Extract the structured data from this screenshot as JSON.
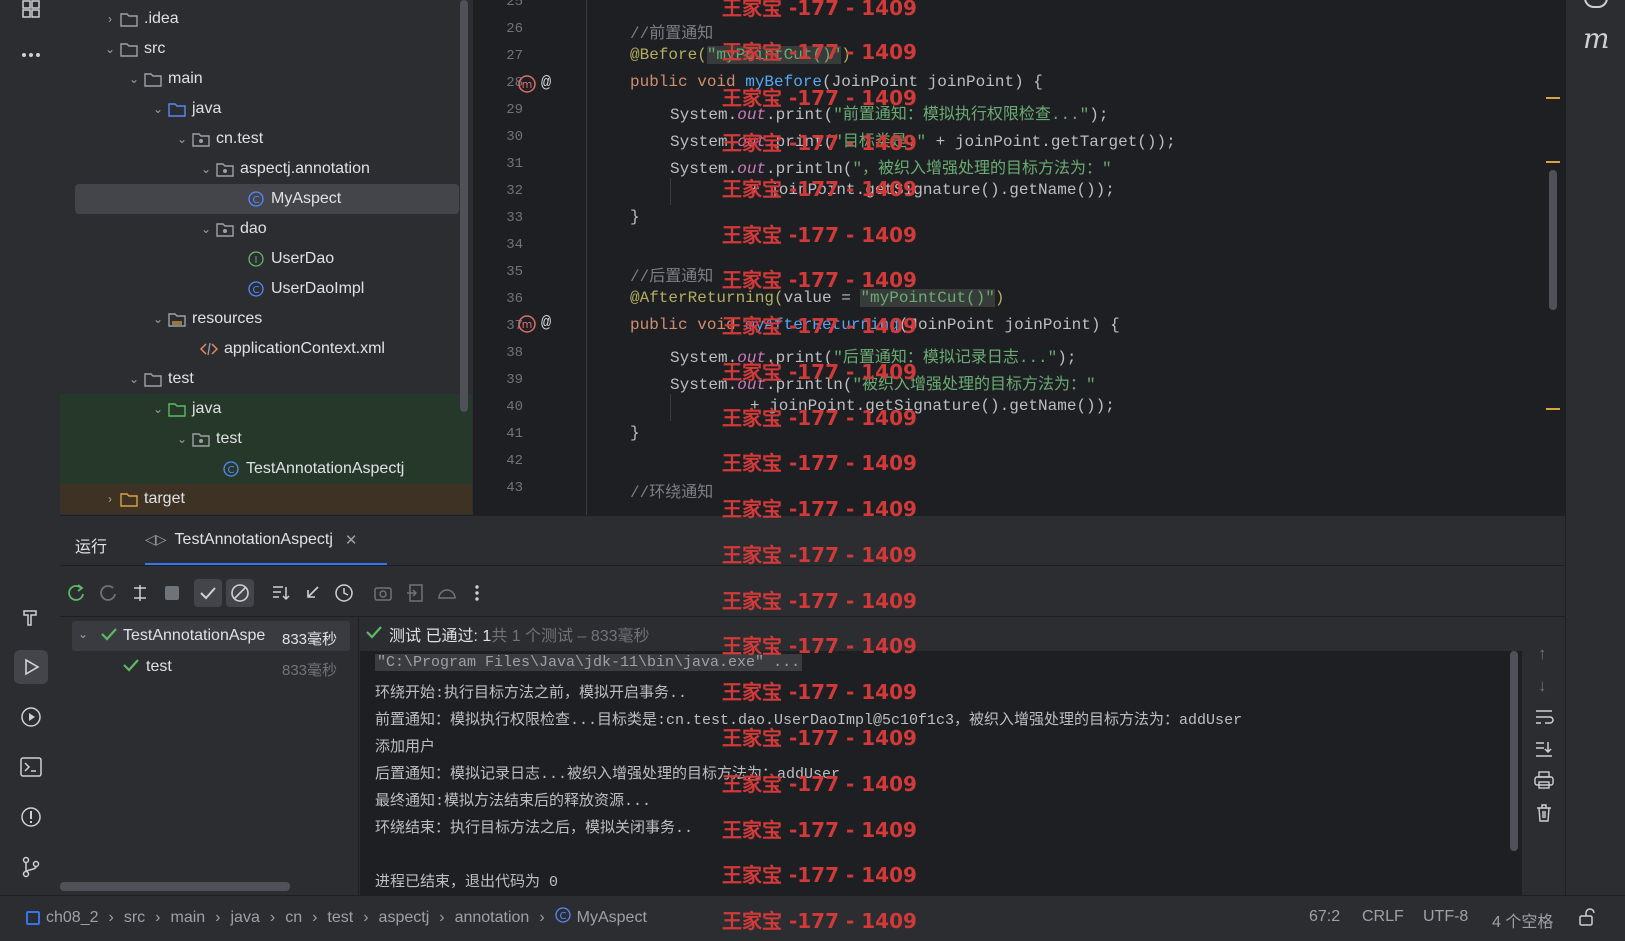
{
  "left_tools": [
    "project-icon",
    "more-icon",
    "build-icon",
    "run-icon",
    "services-icon",
    "terminal-icon",
    "problems-icon",
    "git-icon"
  ],
  "tree": {
    "items": [
      {
        "label": ".idea",
        "type": "folder",
        "expanded": false
      },
      {
        "label": "src",
        "type": "folder",
        "expanded": true
      },
      {
        "label": "main",
        "type": "folder",
        "expanded": true
      },
      {
        "label": "java",
        "type": "source-folder",
        "expanded": true
      },
      {
        "label": "cn.test",
        "type": "package",
        "expanded": true
      },
      {
        "label": "aspectj.annotation",
        "type": "package",
        "expanded": true
      },
      {
        "label": "MyAspect",
        "type": "class"
      },
      {
        "label": "dao",
        "type": "package",
        "expanded": true
      },
      {
        "label": "UserDao",
        "type": "interface"
      },
      {
        "label": "UserDaoImpl",
        "type": "class"
      },
      {
        "label": "resources",
        "type": "resources-folder",
        "expanded": true
      },
      {
        "label": "applicationContext.xml",
        "type": "xml"
      },
      {
        "label": "test",
        "type": "folder",
        "expanded": true
      },
      {
        "label": "java",
        "type": "test-folder",
        "expanded": true
      },
      {
        "label": "test",
        "type": "package",
        "expanded": true
      },
      {
        "label": "TestAnnotationAspectj",
        "type": "class"
      },
      {
        "label": "target",
        "type": "folder",
        "expanded": false
      }
    ]
  },
  "editor": {
    "line_numbers": [
      "25",
      "26",
      "27",
      "28",
      "29",
      "30",
      "31",
      "32",
      "33",
      "34",
      "35",
      "36",
      "37",
      "38",
      "39",
      "40",
      "41",
      "42",
      "43"
    ],
    "lines": {
      "l26": "//前置通知",
      "l27_ann": "@Before(",
      "l27_str": "\"myPointCut()\"",
      "l27_end": ")",
      "l28_kw": "public void ",
      "l28_fn": "myBefore",
      "l28_rest": "(JoinPoint joinPoint) {",
      "sys": "System.",
      "out": "out",
      "print": ".print(",
      "println": ".println(",
      "l29_str": "\"前置通知：模拟执行权限检查...\"",
      "l29_end": ");",
      "l30_str": "\"目标类是:\"",
      "l30_rest": " + joinPoint.getTarget());",
      "l31_str": "\"，被织入增强处理的目标方法为：\"",
      "l32": "+ joinPoint.getSignature().getName());",
      "close": "}",
      "l35": "//后置通知",
      "l36_ann": "@AfterReturning(",
      "l36_mid": "value = ",
      "l36_str": "\"myPointCut()\"",
      "l36_end": ")",
      "l37_fn": "myAfterReturning",
      "l38_str": "\"后置通知：模拟记录日志...\"",
      "l39_str": "\"被织入增强处理的目标方法为：\"",
      "l43": "//环绕通知"
    }
  },
  "run": {
    "tab_run": "运行",
    "tab_config": "TestAnnotationAspectj",
    "tree_root": "TestAnnotationAspe",
    "tree_root_time": "833毫秒",
    "tree_child": "test",
    "tree_child_time": "833毫秒",
    "status_pass": "测试 已通过: 1",
    "status_detail": "共 1 个测试 – 833毫秒",
    "console": [
      "\"C:\\Program Files\\Java\\jdk-11\\bin\\java.exe\" ...",
      "环绕开始:执行目标方法之前，模拟开启事务..",
      "前置通知：模拟执行权限检查...目标类是:cn.test.dao.UserDaoImpl@5c10f1c3，被织入增强处理的目标方法为：addUser",
      "添加用户",
      "后置通知：模拟记录日志...被织入增强处理的目标方法为：addUser",
      "最终通知:模拟方法结束后的释放资源...",
      "环绕结束：执行目标方法之后，模拟关闭事务..",
      "",
      "进程已结束，退出代码为 0"
    ]
  },
  "breadcrumb": [
    "ch08_2",
    "src",
    "main",
    "java",
    "cn",
    "test",
    "aspectj",
    "annotation",
    "MyAspect"
  ],
  "status": {
    "position": "67:2",
    "line_sep": "CRLF",
    "encoding": "UTF-8",
    "indent": "4 个空格"
  },
  "watermark": "王家宝 -177 - 1409",
  "colors": {
    "accent": "#3574f0",
    "pass": "#5fb865",
    "watermark": "#d23a3a"
  }
}
